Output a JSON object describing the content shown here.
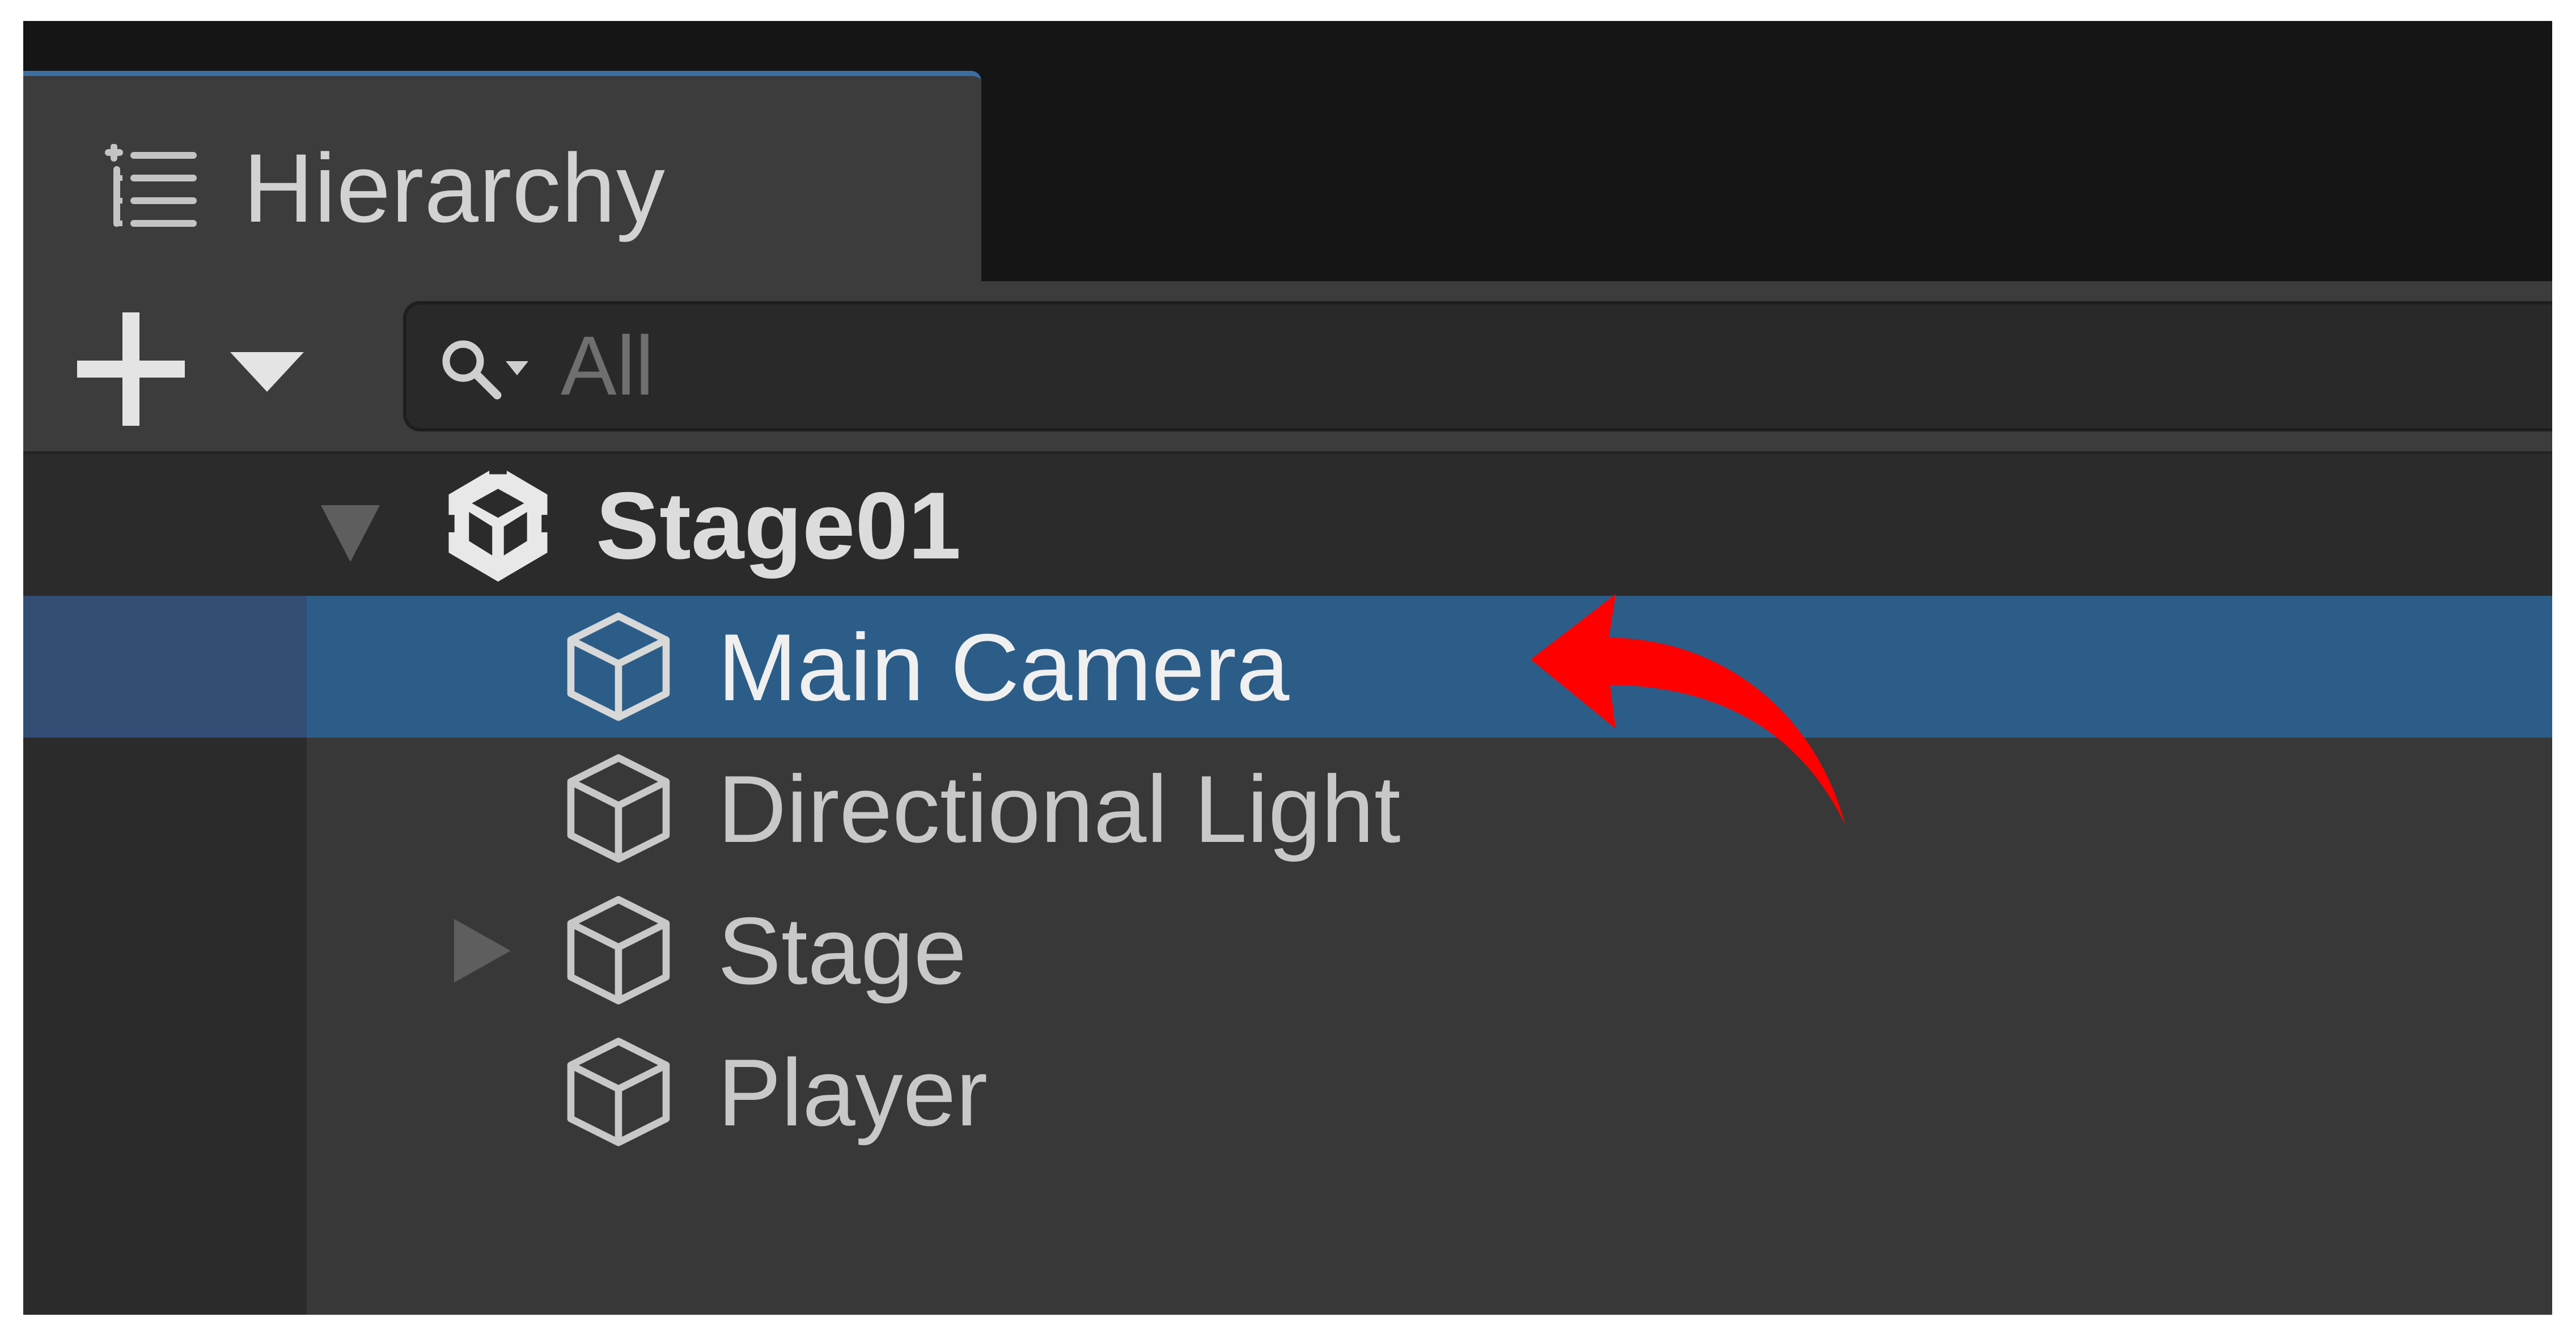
{
  "window": {
    "tab_icon": "list-indent-icon",
    "tab_title": "Hierarchy"
  },
  "toolbar": {
    "add_icon": "plus-icon",
    "add_dropdown_icon": "caret-down-icon",
    "search": {
      "icon": "search-dropdown-icon",
      "placeholder": "All",
      "value": ""
    }
  },
  "hierarchy": {
    "scene": {
      "label": "Stage01",
      "icon": "unity-scene-icon",
      "expanded": true
    },
    "items": [
      {
        "label": "Main Camera",
        "icon": "cube-icon",
        "selected": true,
        "has_children": false
      },
      {
        "label": "Directional Light",
        "icon": "cube-icon",
        "selected": false,
        "has_children": false
      },
      {
        "label": "Stage",
        "icon": "cube-icon",
        "selected": false,
        "has_children": true,
        "expanded": false
      },
      {
        "label": "Player",
        "icon": "cube-icon",
        "selected": false,
        "has_children": false
      }
    ]
  },
  "annotation": {
    "icon": "curved-arrow-icon",
    "color": "#ff0000"
  },
  "colors": {
    "selection": "#2c5d88",
    "tab_accent": "#3a6fa6",
    "panel": "#383838"
  }
}
